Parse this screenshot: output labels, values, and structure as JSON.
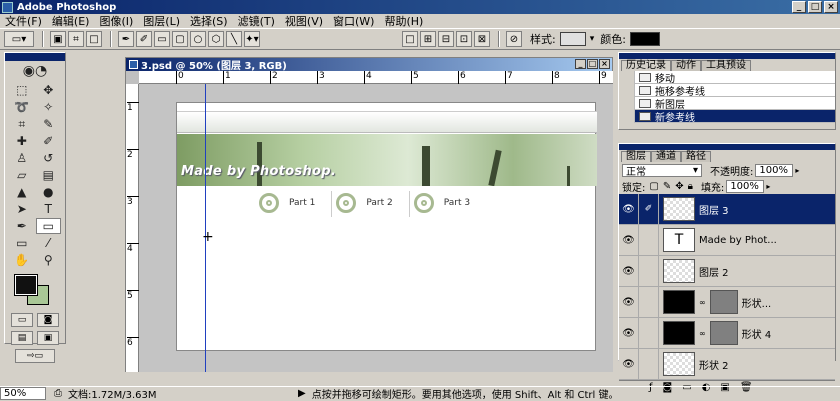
{
  "app": {
    "title": "Adobe Photoshop"
  },
  "menu": [
    "文件(F)",
    "编辑(E)",
    "图像(I)",
    "图层(L)",
    "选择(S)",
    "滤镜(T)",
    "视图(V)",
    "窗口(W)",
    "帮助(H)"
  ],
  "options": {
    "style_label": "样式:",
    "color_label": "颜色:",
    "color_value": "#000000"
  },
  "document": {
    "title": "3.psd @ 50% (图层 3, RGB)",
    "h_ticks": [
      "0",
      "1",
      "2",
      "3",
      "4",
      "5",
      "6",
      "7",
      "8",
      "9"
    ],
    "v_ticks": [
      "1",
      "2",
      "3",
      "4",
      "5",
      "6"
    ]
  },
  "design": {
    "banner_text": "Made by Photoshop.",
    "parts": [
      "Part 1",
      "Part 2",
      "Part 3"
    ]
  },
  "history": {
    "tabs": [
      "历史记录",
      "动作",
      "工具预设"
    ],
    "items": [
      {
        "label": "移动",
        "selected": false
      },
      {
        "label": "拖移参考线",
        "selected": false
      },
      {
        "label": "新图层",
        "selected": false
      },
      {
        "label": "新参考线",
        "selected": true
      }
    ]
  },
  "layers": {
    "tabs": [
      "图层",
      "通道",
      "路径"
    ],
    "blend_mode": "正常",
    "opacity_label": "不透明度:",
    "opacity": "100%",
    "lock_label": "锁定:",
    "fill_label": "填充:",
    "fill": "100%",
    "items": [
      {
        "name": "图层 3",
        "kind": "raster",
        "selected": true
      },
      {
        "name": "Made by Phot...",
        "kind": "text",
        "selected": false
      },
      {
        "name": "图层 2",
        "kind": "raster",
        "selected": false
      },
      {
        "name": "形状...",
        "kind": "shape",
        "selected": false
      },
      {
        "name": "形状 4",
        "kind": "shape",
        "selected": false
      },
      {
        "name": "形状 2",
        "kind": "raster",
        "selected": false
      }
    ]
  },
  "status": {
    "zoom": "50%",
    "doc_size": "文档:1.72M/3.63M",
    "hint": "点按并拖移可绘制矩形。要用其他选项，使用 Shift、Alt 和 Ctrl 键。"
  }
}
